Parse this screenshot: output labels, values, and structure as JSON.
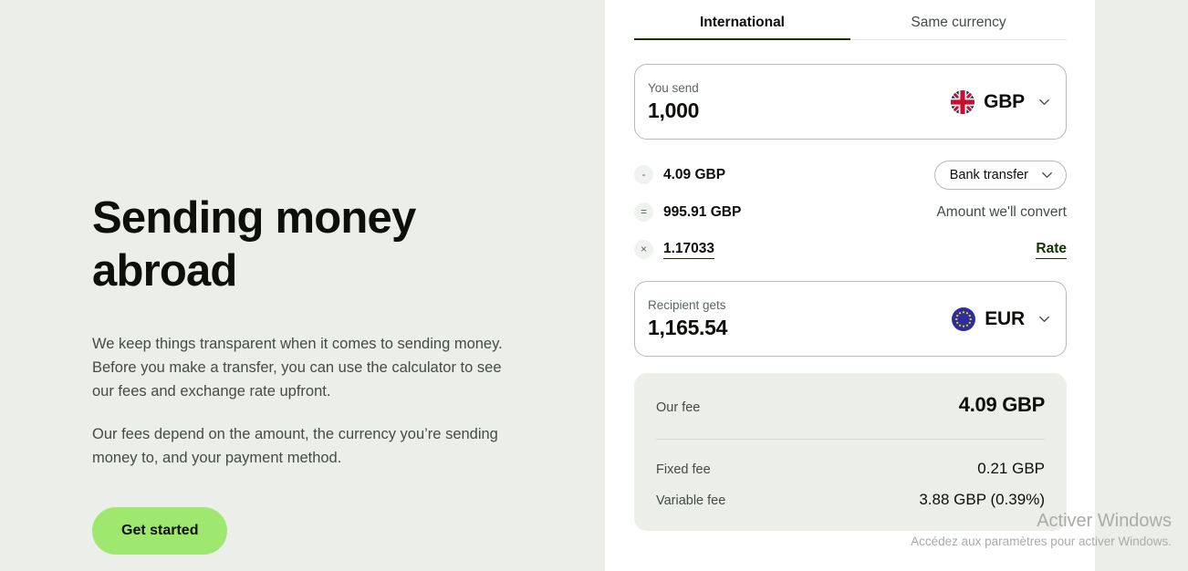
{
  "hero": {
    "title": "Sending money abroad",
    "paragraph_1": "We keep things transparent when it comes to sending money. Before you make a transfer, you can use the calculator to see our fees and exchange rate upfront.",
    "paragraph_2": "Our fees depend on the amount, the currency you’re sending money to, and your payment method.",
    "cta_label": "Get started"
  },
  "calculator": {
    "tabs": [
      {
        "label": "International",
        "active": true
      },
      {
        "label": "Same currency",
        "active": false
      }
    ],
    "send": {
      "label": "You send",
      "value": "1,000",
      "currency": "GBP",
      "flag": "gb-flag-icon",
      "chevron": "chevron-down-icon"
    },
    "rows": [
      {
        "operator": "-",
        "operator_name": "minus-operator",
        "value": "4.09 GBP",
        "right_label": "Bank transfer",
        "right_type": "dropdown"
      },
      {
        "operator": "=",
        "operator_name": "equals-operator",
        "value": "995.91 GBP",
        "right_label": "Amount we'll convert",
        "right_type": "text"
      },
      {
        "operator": "×",
        "operator_name": "multiply-operator",
        "value": "1.17033",
        "right_label": "Rate",
        "right_type": "link"
      }
    ],
    "receive": {
      "label": "Recipient gets",
      "value": "1,165.54",
      "currency": "EUR",
      "flag": "eu-flag-icon",
      "chevron": "chevron-down-icon"
    },
    "summary": {
      "total_label": "Our fee",
      "total_value": "4.09 GBP",
      "lines": [
        {
          "label": "Fixed fee",
          "value": "0.21 GBP"
        },
        {
          "label": "Variable fee",
          "value": "3.88 GBP (0.39%)"
        }
      ]
    }
  },
  "watermark": {
    "title": "Activer Windows",
    "subtitle": "Accédez aux paramètres pour activer Windows."
  },
  "colors": {
    "page_background": "#eceee9",
    "panel_background": "#ffffff",
    "accent_green": "#9fe870",
    "dark_green": "#163300",
    "text_primary": "#0e0f0c",
    "text_secondary": "#454b47"
  }
}
